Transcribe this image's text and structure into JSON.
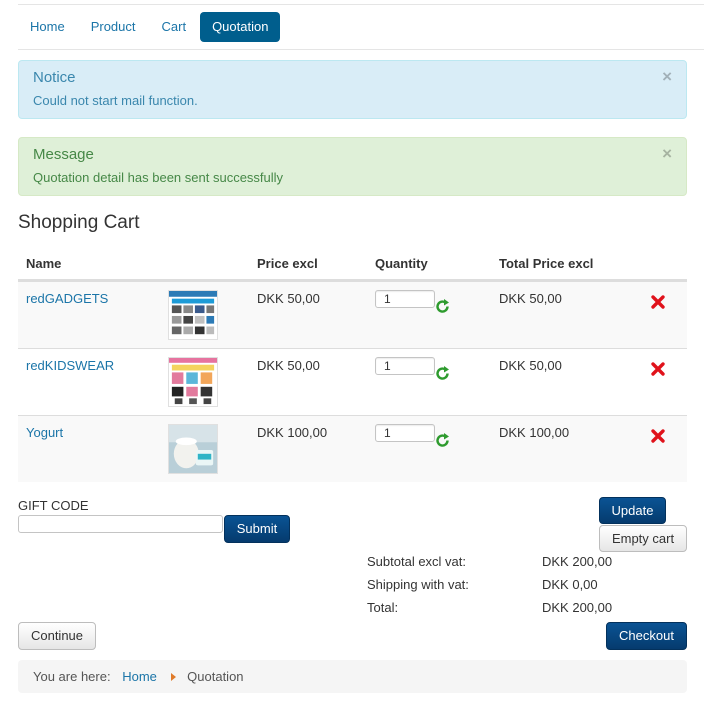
{
  "nav": {
    "tabs": [
      {
        "label": "Home",
        "active": false
      },
      {
        "label": "Product",
        "active": false
      },
      {
        "label": "Cart",
        "active": false
      },
      {
        "label": "Quotation",
        "active": true
      }
    ]
  },
  "alerts": {
    "notice": {
      "title": "Notice",
      "text": "Could not start mail function.",
      "close": "×"
    },
    "message": {
      "title": "Message",
      "text": "Quotation detail has been sent successfully",
      "close": "×"
    }
  },
  "cart": {
    "title": "Shopping Cart",
    "columns": {
      "name": "Name",
      "price": "Price excl",
      "quantity": "Quantity",
      "total": "Total Price excl"
    },
    "items": [
      {
        "name": "redGADGETS",
        "price": "DKK 50,00",
        "quantity": "1",
        "total": "DKK 50,00"
      },
      {
        "name": "redKIDSWEAR",
        "price": "DKK 50,00",
        "quantity": "1",
        "total": "DKK 50,00"
      },
      {
        "name": "Yogurt",
        "price": "DKK 100,00",
        "quantity": "1",
        "total": "DKK 100,00"
      }
    ]
  },
  "gift": {
    "label": "GIFT CODE",
    "value": "",
    "submit_label": "Submit"
  },
  "actions": {
    "update_label": "Update",
    "empty_label": "Empty cart",
    "continue_label": "Continue",
    "checkout_label": "Checkout"
  },
  "totals": {
    "subtotal_label": "Subtotal excl vat:",
    "subtotal_value": "DKK 200,00",
    "shipping_label": "Shipping with vat:",
    "shipping_value": "DKK 0,00",
    "total_label": "Total:",
    "total_value": "DKK 200,00"
  },
  "breadcrumb": {
    "prefix": "You are here:",
    "home": "Home",
    "current": "Quotation"
  },
  "colors": {
    "accent": "#005e8d",
    "link": "#1b75a8",
    "delete": "#e0121b",
    "refresh": "#2e9b2e"
  }
}
